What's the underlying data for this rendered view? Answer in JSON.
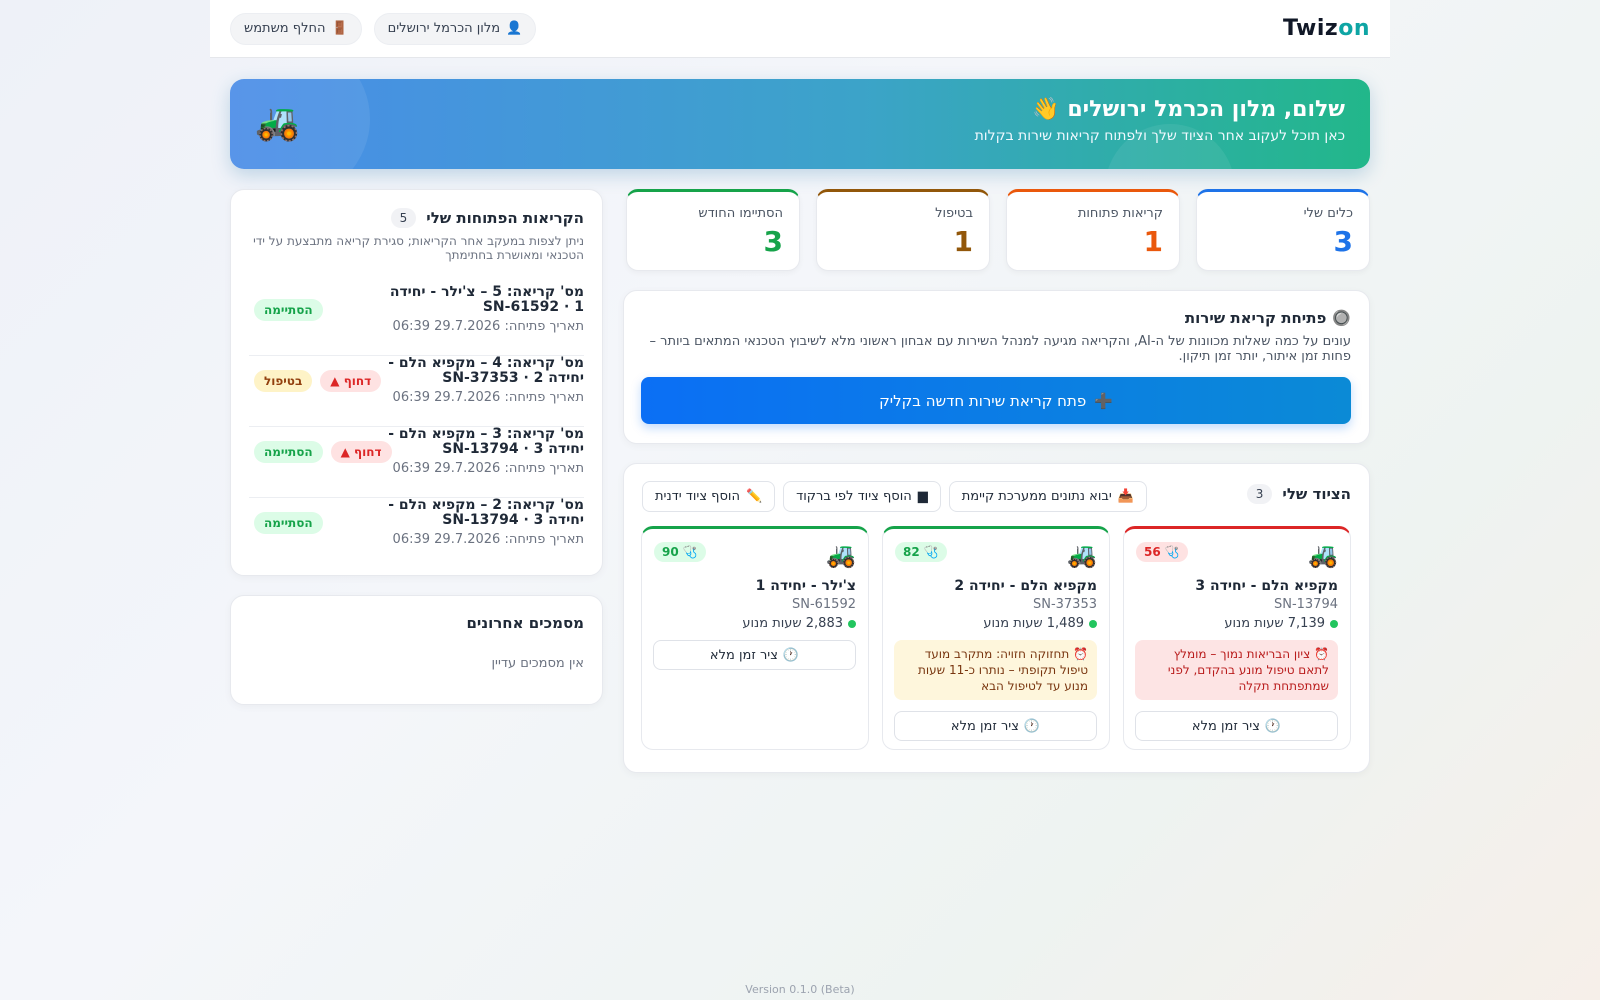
{
  "header": {
    "logo_part1": "Twiz",
    "logo_part2": "on",
    "user_label": "מלון הכרמל ירושלים",
    "user_icon": "user-icon",
    "switch_label": "החלף משתמש",
    "switch_icon": "door-icon"
  },
  "hero": {
    "title": "שלום, מלון הכרמל ירושלים 👋",
    "subtitle": "כאן תוכל לעקוב אחר הציוד שלך ולפתוח קריאות שירות בקלות",
    "icon": "tractor-icon"
  },
  "stats": [
    {
      "label": "כלים שלי",
      "value": "3",
      "color": "#1e73e8"
    },
    {
      "label": "קריאות פתוחות",
      "value": "1",
      "color": "#ea580c"
    },
    {
      "label": "בטיפול",
      "value": "1",
      "color": "#92570a"
    },
    {
      "label": "הסתיימו החודש",
      "value": "3",
      "color": "#16a34a"
    }
  ],
  "service": {
    "title": "פתיחת קריאת שירות",
    "icon": "radio-button-icon",
    "description": "עונים על כמה שאלות מכוונות של ה-AI, והקריאה מגיעה למנהל השירות עם אבחון ראשוני מלא לשיבוץ הטכנאי המתאים ביותר – פחות זמן איתור, יותר זמן תיקון.",
    "button_label": "פתח קריאת שירות חדשה בקליק",
    "button_icon": "plus-icon"
  },
  "equipment": {
    "title": "הציוד שלי",
    "count": "3",
    "actions": [
      {
        "label": "יבוא נתונים ממערכת קיימת",
        "icon": "inbox-tray-icon"
      },
      {
        "label": "הוסף ציוד לפי ברקוד",
        "icon": "barcode-icon"
      },
      {
        "label": "הוסף ציוד ידנית",
        "icon": "pencil-icon"
      }
    ],
    "items": [
      {
        "name": "מקפיא הלם - יחידה 3",
        "serial": "SN-13794",
        "hours": "7,139 שעות מנוע",
        "score": "56",
        "status": "bad",
        "accent": "#dc2626",
        "alert": "⏰ ציון הבריאות נמוך – מומלץ לתאם טיפול מונע בהקדם, לפני שמתפתחת תקלה",
        "alert_type": "danger",
        "timeline_label": "ציר זמן מלא"
      },
      {
        "name": "מקפיא הלם - יחידה 2",
        "serial": "SN-37353",
        "hours": "1,489 שעות מנוע",
        "score": "82",
        "status": "good",
        "accent": "#16a34a",
        "alert": "⏰ תחזוקה חזויה: מתקרב מועד טיפול תקופתי – נותרו כ-11 שעות מנוע עד לטיפול הבא",
        "alert_type": "warn",
        "timeline_label": "ציר זמן מלא"
      },
      {
        "name": "צ'ילר - יחידה 1",
        "serial": "SN-61592",
        "hours": "2,883 שעות מנוע",
        "score": "90",
        "status": "good",
        "accent": "#16a34a",
        "alert": "",
        "alert_type": "",
        "timeline_label": "ציר זמן מלא"
      }
    ]
  },
  "tickets": {
    "title": "הקריאות הפתוחות שלי",
    "count": "5",
    "description": "ניתן לצפות במעקב אחר הקריאות; סגירת קריאה מתבצעת על ידי הטכנאי ומאושרת בחתימתך",
    "items": [
      {
        "title": "מס' קריאה: 5 – צ'ילר - יחידה 1 · SN-61592",
        "date": "תאריך פתיחה: 29.7.2026 06:39",
        "status": "הסתיימה",
        "status_type": "done",
        "urgent": ""
      },
      {
        "title": "מס' קריאה: 4 – מקפיא הלם - יחידה 2 · SN-37353",
        "date": "תאריך פתיחה: 29.7.2026 06:39",
        "status": "בטיפול",
        "status_type": "treat",
        "urgent": "▲ דחוף"
      },
      {
        "title": "מס' קריאה: 3 – מקפיא הלם - יחידה 3 · SN-13794",
        "date": "תאריך פתיחה: 29.7.2026 06:39",
        "status": "הסתיימה",
        "status_type": "done",
        "urgent": "▲ דחוף"
      },
      {
        "title": "מס' קריאה: 2 – מקפיא הלם - יחידה 3 · SN-13794",
        "date": "תאריך פתיחה: 29.7.2026 06:39",
        "status": "הסתיימה",
        "status_type": "done",
        "urgent": ""
      }
    ]
  },
  "documents": {
    "title": "מסמכים אחרונים",
    "empty": "אין מסמכים עדיין"
  },
  "footer": {
    "version": "Version 0.1.0 (Beta)"
  }
}
